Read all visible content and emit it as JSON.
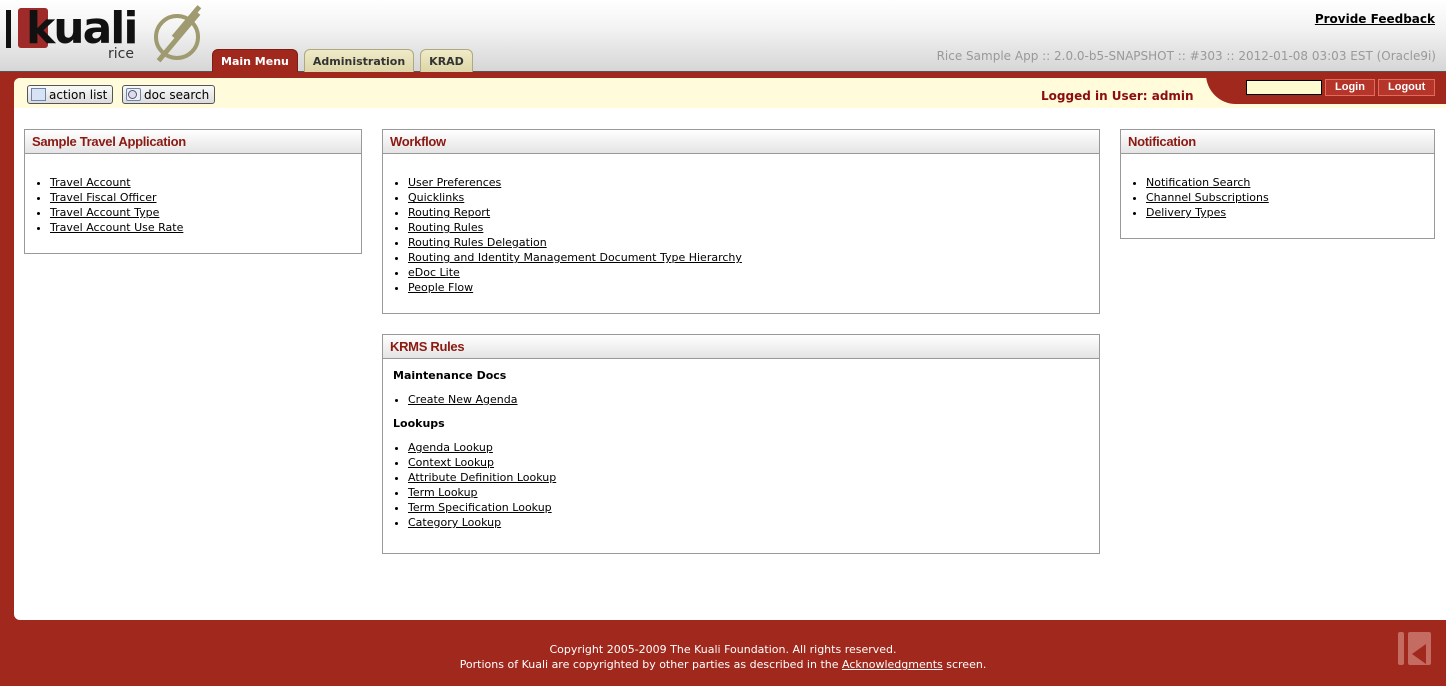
{
  "header": {
    "logo_text": "kuali",
    "logo_sub": "rice",
    "feedback_link": "Provide Feedback",
    "app_info": "Rice Sample App :: 2.0.0-b5-SNAPSHOT :: #303 :: 2012-01-08 03:03 EST (Oracle9i)",
    "tabs": [
      {
        "label": "Main Menu",
        "active": true
      },
      {
        "label": "Administration",
        "active": false
      },
      {
        "label": "KRAD",
        "active": false
      }
    ]
  },
  "toolbar": {
    "action_list_label": "action list",
    "doc_search_label": "doc search",
    "logged_in_text": "Logged in User: admin",
    "login_input_value": "",
    "login_label": "Login",
    "logout_label": "Logout"
  },
  "sections": {
    "travel": {
      "title": "Sample Travel Application",
      "links": [
        "Travel Account",
        "Travel Fiscal Officer",
        "Travel Account Type",
        "Travel Account Use Rate"
      ]
    },
    "workflow": {
      "title": "Workflow",
      "links": [
        "User Preferences",
        "Quicklinks",
        "Routing Report",
        "Routing Rules",
        "Routing Rules Delegation",
        "Routing and Identity Management Document Type Hierarchy",
        "eDoc Lite",
        "People Flow"
      ]
    },
    "krms": {
      "title": "KRMS Rules",
      "maintenance_heading": "Maintenance Docs",
      "maintenance_links": [
        "Create New Agenda"
      ],
      "lookups_heading": "Lookups",
      "lookup_links": [
        "Agenda Lookup",
        "Context Lookup",
        "Attribute Definition Lookup",
        "Term Lookup",
        "Term Specification Lookup",
        "Category Lookup"
      ]
    },
    "notification": {
      "title": "Notification",
      "links": [
        "Notification Search",
        "Channel Subscriptions",
        "Delivery Types"
      ]
    }
  },
  "footer": {
    "line1": "Copyright 2005-2009 The Kuali Foundation. All rights reserved.",
    "line2_pre": "Portions of Kuali are copyrighted by other parties as described in the ",
    "line2_link": "Acknowledgments",
    "line2_post": " screen."
  },
  "colors": {
    "brand_red": "#a0281c",
    "header_title_red": "#8b1a12",
    "toolbar_bg": "#fffbdb",
    "tab_inactive": "#dcd6a8"
  }
}
